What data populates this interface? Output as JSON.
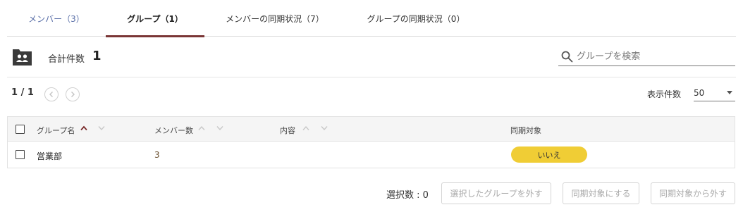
{
  "tabs": [
    {
      "label": "メンバー（3）"
    },
    {
      "label": "グループ（1）"
    },
    {
      "label": "メンバーの同期状況（7）"
    },
    {
      "label": "グループの同期状況（0）"
    }
  ],
  "summary": {
    "total_label": "合計件数",
    "total_value": "1",
    "search_placeholder": "グループを検索"
  },
  "pagination": {
    "page_text": "1 / 1",
    "per_page_label": "表示件数",
    "per_page_value": "50"
  },
  "table": {
    "headers": {
      "name": "グループ名",
      "members": "メンバー数",
      "content": "内容",
      "sync": "同期対象"
    },
    "rows": [
      {
        "name": "営業部",
        "members": "3",
        "content": "",
        "sync": "いいえ"
      }
    ]
  },
  "footer": {
    "selected_label": "選択数 : 0",
    "remove_button": "選択したグループを外す",
    "sync_on_button": "同期対象にする",
    "sync_off_button": "同期対象から外す"
  },
  "colors": {
    "accent_tab_underline": "#7a3535",
    "badge_yellow": "#f0cd35",
    "first_tab_text": "#5a6fa8"
  }
}
